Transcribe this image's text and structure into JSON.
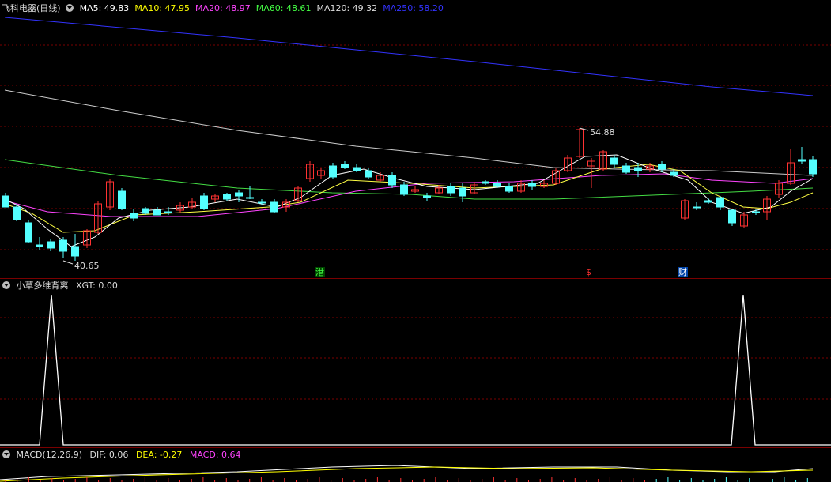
{
  "main": {
    "title": "飞科电器(日线)",
    "ma_labels": [
      {
        "text": "MA5: 49.83",
        "color": "#ffffff"
      },
      {
        "text": "MA10: 47.95",
        "color": "#ffff00"
      },
      {
        "text": "MA20: 48.97",
        "color": "#ff44ff"
      },
      {
        "text": "MA60: 48.61",
        "color": "#44ff44"
      },
      {
        "text": "MA120: 49.32",
        "color": "#dddddd"
      },
      {
        "text": "MA250: 58.20",
        "color": "#3333ff"
      }
    ],
    "high_label": "54.88",
    "low_label": "40.65",
    "markers": {
      "gang": "港",
      "dollar": "$",
      "cai": "财"
    }
  },
  "indicator": {
    "title": "小草多维背离",
    "value_label": "XGT: 0.00"
  },
  "macd": {
    "title": "MACD(12,26,9)",
    "dif": "DIF: 0.06",
    "dea": "DEA: -0.27",
    "macd": "MACD: 0.64"
  },
  "colors": {
    "up": "#ff3232",
    "down": "#54ffff",
    "grid": "#7a0000"
  }
}
